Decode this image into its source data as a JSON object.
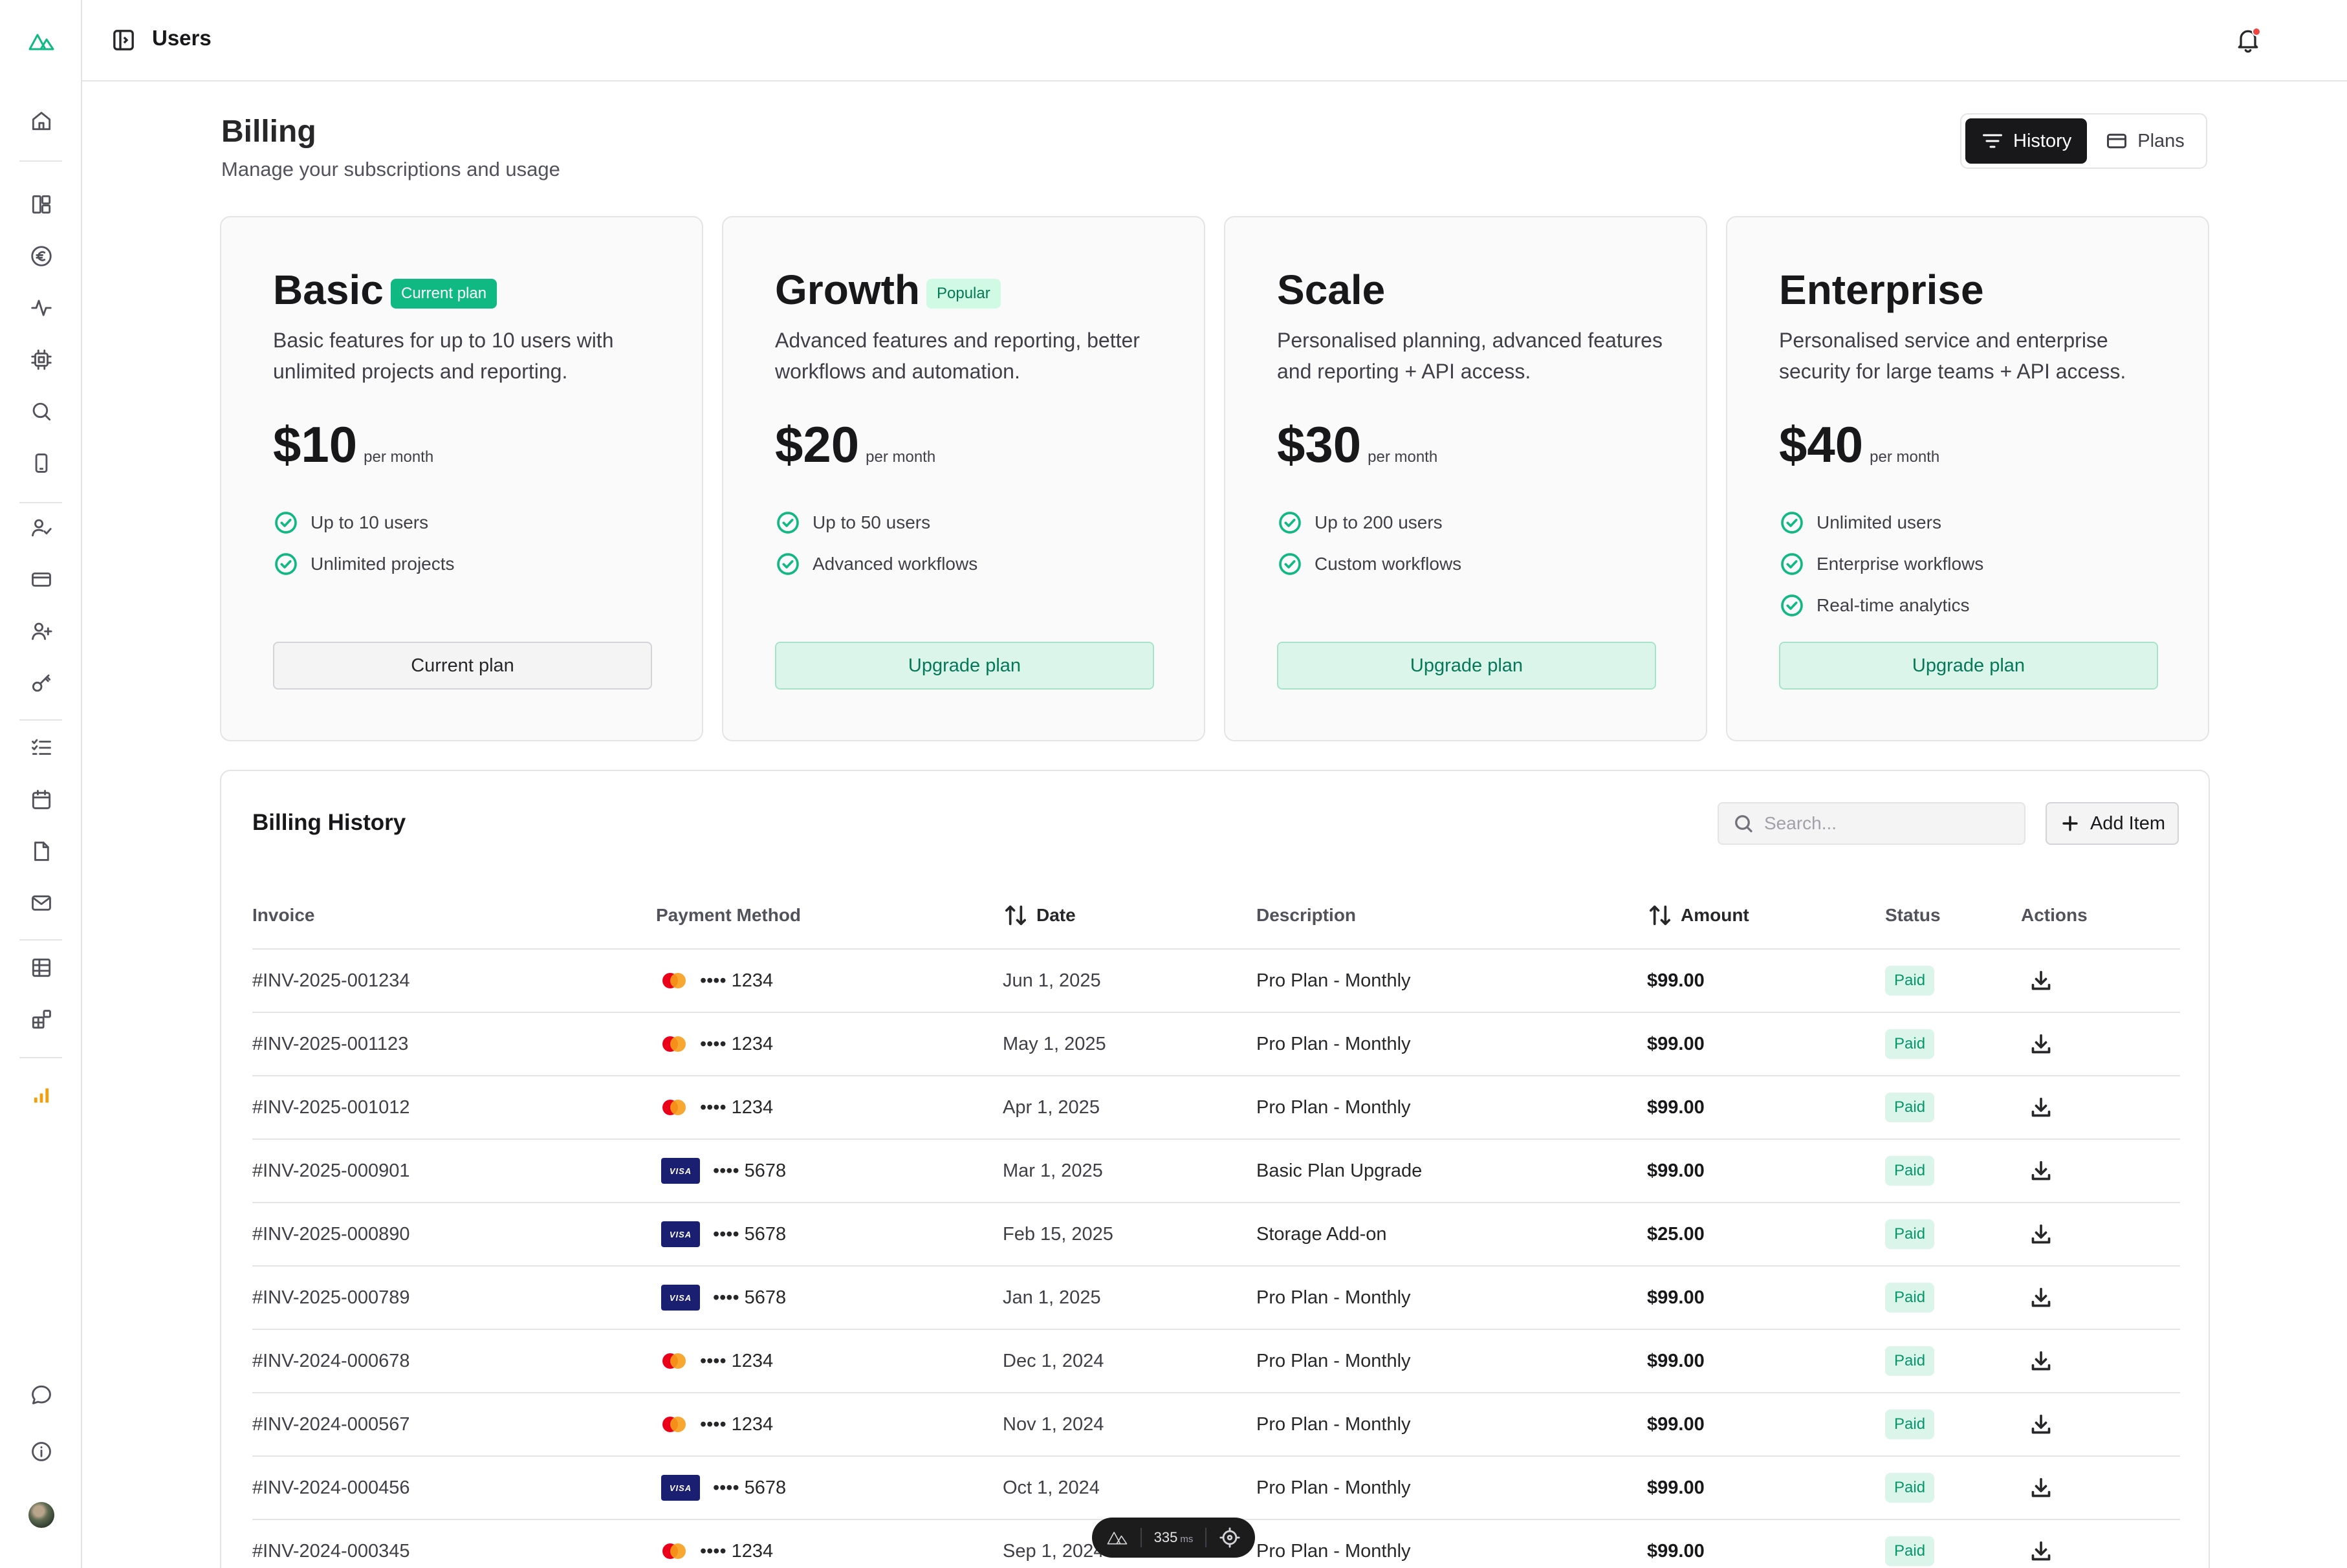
{
  "topbar": {
    "title": "Users"
  },
  "header": {
    "title": "Billing",
    "subtitle": "Manage your subscriptions and usage"
  },
  "view_toggle": {
    "history_label": "History",
    "plans_label": "Plans",
    "active": "History"
  },
  "plans": [
    {
      "name": "Basic",
      "badge": "Current plan",
      "description": "Basic features for up to 10 users with unlimited projects and reporting.",
      "price": "$10",
      "period": "per month",
      "features": [
        "Up to 10 users",
        "Unlimited projects"
      ],
      "cta": "Current plan"
    },
    {
      "name": "Growth",
      "badge": "Popular",
      "description": "Advanced features and reporting, better workflows and automation.",
      "price": "$20",
      "period": "per month",
      "features": [
        "Up to 50 users",
        "Advanced workflows"
      ],
      "cta": "Upgrade plan"
    },
    {
      "name": "Scale",
      "badge": "",
      "description": "Personalised planning, advanced features and reporting + API access.",
      "price": "$30",
      "period": "per month",
      "features": [
        "Up to 200 users",
        "Custom workflows"
      ],
      "cta": "Upgrade plan"
    },
    {
      "name": "Enterprise",
      "badge": "",
      "description": "Personalised service and enterprise security for large teams + API access.",
      "price": "$40",
      "period": "per month",
      "features": [
        "Unlimited users",
        "Enterprise workflows",
        "Real-time analytics"
      ],
      "cta": "Upgrade plan"
    }
  ],
  "billing_history": {
    "title": "Billing History",
    "search_placeholder": "Search...",
    "add_item_label": "Add Item",
    "columns": [
      "Invoice",
      "Payment Method",
      "Date",
      "Description",
      "Amount",
      "Status",
      "Actions"
    ],
    "rows": [
      {
        "invoice": "#INV-2025-001234",
        "card": "mastercard",
        "last4": "•••• 1234",
        "date": "Jun 1, 2025",
        "description": "Pro Plan - Monthly",
        "amount": "$99.00",
        "status": "Paid"
      },
      {
        "invoice": "#INV-2025-001123",
        "card": "mastercard",
        "last4": "•••• 1234",
        "date": "May 1, 2025",
        "description": "Pro Plan - Monthly",
        "amount": "$99.00",
        "status": "Paid"
      },
      {
        "invoice": "#INV-2025-001012",
        "card": "mastercard",
        "last4": "•••• 1234",
        "date": "Apr 1, 2025",
        "description": "Pro Plan - Monthly",
        "amount": "$99.00",
        "status": "Paid"
      },
      {
        "invoice": "#INV-2025-000901",
        "card": "visa",
        "last4": "•••• 5678",
        "date": "Mar 1, 2025",
        "description": "Basic Plan Upgrade",
        "amount": "$99.00",
        "status": "Paid"
      },
      {
        "invoice": "#INV-2025-000890",
        "card": "visa",
        "last4": "•••• 5678",
        "date": "Feb 15, 2025",
        "description": "Storage Add-on",
        "amount": "$25.00",
        "status": "Paid"
      },
      {
        "invoice": "#INV-2025-000789",
        "card": "visa",
        "last4": "•••• 5678",
        "date": "Jan 1, 2025",
        "description": "Pro Plan - Monthly",
        "amount": "$99.00",
        "status": "Paid"
      },
      {
        "invoice": "#INV-2024-000678",
        "card": "mastercard",
        "last4": "•••• 1234",
        "date": "Dec 1, 2024",
        "description": "Pro Plan - Monthly",
        "amount": "$99.00",
        "status": "Paid"
      },
      {
        "invoice": "#INV-2024-000567",
        "card": "mastercard",
        "last4": "•••• 1234",
        "date": "Nov 1, 2024",
        "description": "Pro Plan - Monthly",
        "amount": "$99.00",
        "status": "Paid"
      },
      {
        "invoice": "#INV-2024-000456",
        "card": "visa",
        "last4": "•••• 5678",
        "date": "Oct 1, 2024",
        "description": "Pro Plan - Monthly",
        "amount": "$99.00",
        "status": "Paid"
      },
      {
        "invoice": "#INV-2024-000345",
        "card": "mastercard",
        "last4": "•••• 1234",
        "date": "Sep 1, 2024",
        "description": "Pro Plan - Monthly",
        "amount": "$99.00",
        "status": "Paid"
      }
    ]
  },
  "card_brand_text": {
    "visa": "VISA"
  },
  "perf_pill": {
    "value": "335",
    "unit": "ms"
  },
  "sidebar": {
    "icons": [
      "home-icon",
      "layout-icon",
      "euro-icon",
      "activity-icon",
      "cpu-icon",
      "search-icon",
      "phone-icon",
      "user-check-icon",
      "credit-card-icon",
      "user-plus-icon",
      "key-icon",
      "list-checks-icon",
      "calendar-icon",
      "file-icon",
      "mail-icon",
      "table-icon",
      "blocks-icon",
      "chart-bars-icon",
      "message-icon",
      "info-icon"
    ]
  },
  "colors": {
    "accent": "#10b981",
    "accent_soft": "#dcf5ea",
    "dark": "#18181b",
    "notification": "#ef4444",
    "chart_icon": "#f59e0b"
  }
}
